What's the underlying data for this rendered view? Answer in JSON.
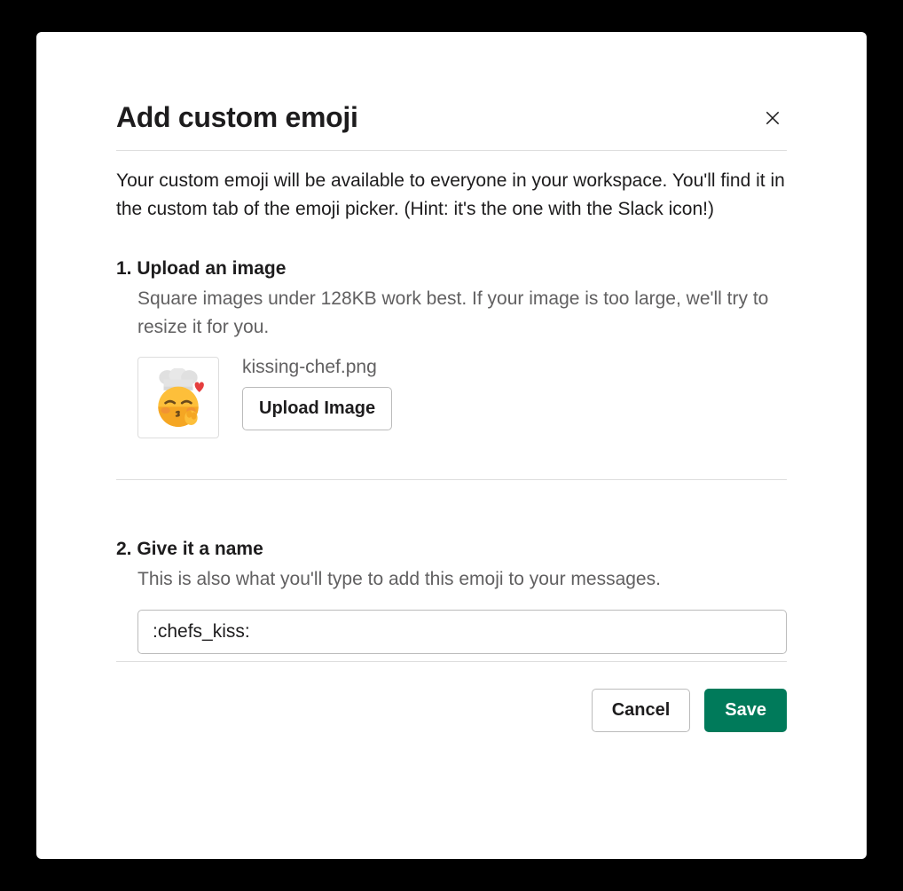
{
  "modal": {
    "title": "Add custom emoji",
    "description": "Your custom emoji will be available to everyone in your workspace. You'll find it in the custom tab of the emoji picker. (Hint: it's the one with the Slack icon!)"
  },
  "upload": {
    "heading": "1. Upload an image",
    "hint": "Square images under 128KB work best. If your image is too large, we'll try to resize it for you.",
    "filename": "kissing-chef.png",
    "button_label": "Upload Image"
  },
  "name": {
    "heading": "2. Give it a name",
    "hint": "This is also what you'll type to add this emoji to your messages.",
    "value": ":chefs_kiss:"
  },
  "footer": {
    "cancel_label": "Cancel",
    "save_label": "Save"
  }
}
